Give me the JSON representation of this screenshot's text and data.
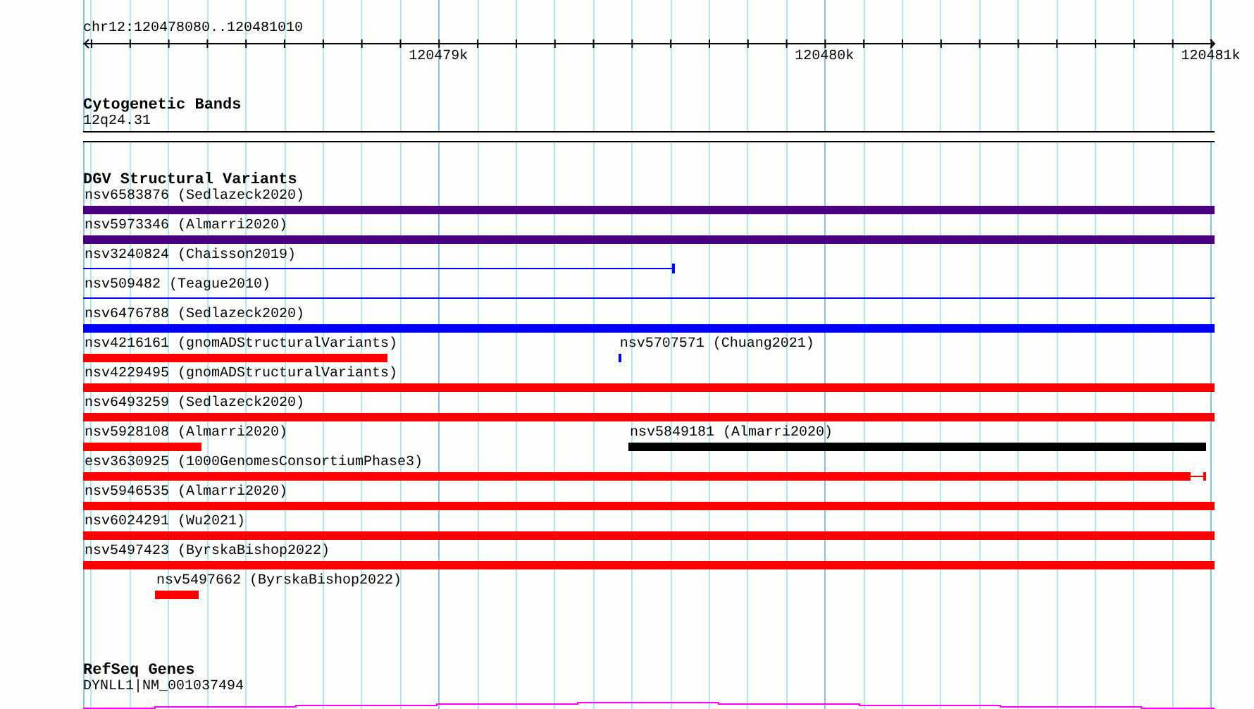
{
  "ruler": {
    "location": "chr12:120478080..120481010",
    "ticks": [
      "120479k",
      "120480k",
      "120481k"
    ]
  },
  "tracks": [
    {
      "kind": "cytoband",
      "title": "Cytogenetic Bands",
      "features": [
        {
          "label": "12q24.31"
        }
      ]
    },
    {
      "kind": "variants",
      "title": "DGV Structural Variants",
      "rows": [
        [
          {
            "label": "nsv6583876 (Sedlazeck2020)",
            "kind": "bar",
            "color": "#4b0082"
          }
        ],
        [
          {
            "label": "nsv5973346 (Almarri2020)",
            "kind": "bar",
            "color": "#4b0082"
          }
        ],
        [
          {
            "label": "nsv3240824 (Chaisson2019)",
            "kind": "line",
            "color": "#0000ff"
          }
        ],
        [
          {
            "label": "nsv509482 (Teague2010)",
            "kind": "line",
            "color": "#0000ff"
          }
        ],
        [
          {
            "label": "nsv6476788 (Sedlazeck2020)",
            "kind": "bar",
            "color": "#0000ff"
          }
        ],
        [
          {
            "label": "nsv4216161 (gnomADStructuralVariants)",
            "kind": "bar",
            "color": "#ff0000"
          },
          {
            "label": "nsv5707571 (Chuang2021)",
            "kind": "bar",
            "color": "#0000ff"
          }
        ],
        [
          {
            "label": "nsv4229495 (gnomADStructuralVariants)",
            "kind": "bar",
            "color": "#ff0000"
          }
        ],
        [
          {
            "label": "nsv6493259 (Sedlazeck2020)",
            "kind": "bar",
            "color": "#ff0000"
          }
        ],
        [
          {
            "label": "nsv5928108 (Almarri2020)",
            "kind": "bar",
            "color": "#ff0000"
          },
          {
            "label": "nsv5849181 (Almarri2020)",
            "kind": "bar",
            "color": "#000000"
          }
        ],
        [
          {
            "label": "esv3630925 (1000GenomesConsortiumPhase3)",
            "kind": "bar_tail",
            "color": "#ff0000"
          }
        ],
        [
          {
            "label": "nsv5946535 (Almarri2020)",
            "kind": "bar",
            "color": "#ff0000"
          }
        ],
        [
          {
            "label": "nsv6024291 (Wu2021)",
            "kind": "bar",
            "color": "#ff0000"
          }
        ],
        [
          {
            "label": "nsv5497423 (ByrskaBishop2022)",
            "kind": "bar",
            "color": "#ff0000"
          }
        ],
        [
          {
            "label": "nsv5497662 (ByrskaBishop2022)",
            "kind": "bar",
            "color": "#ff0000"
          }
        ]
      ]
    },
    {
      "kind": "genes",
      "title": "RefSeq Genes",
      "features": [
        {
          "label": "DYNLL1|NM_001037494",
          "color": "#ff00ff"
        }
      ]
    }
  ]
}
